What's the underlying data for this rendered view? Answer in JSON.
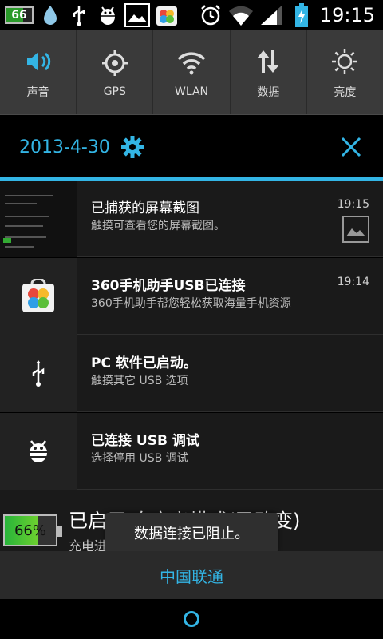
{
  "status_bar": {
    "battery_badge": "66",
    "time": "19:15",
    "icons": [
      "battery-level-icon",
      "droplet-icon",
      "usb-icon",
      "android-debug-icon",
      "picture-icon",
      "360-assistant-icon",
      "alarm-icon",
      "wifi-icon",
      "signal-icon",
      "charging-battery-icon"
    ]
  },
  "quick_settings": [
    {
      "label": "声音",
      "icon": "speaker-icon"
    },
    {
      "label": "GPS",
      "icon": "gps-icon"
    },
    {
      "label": "WLAN",
      "icon": "wifi-icon"
    },
    {
      "label": "数据",
      "icon": "data-transfer-icon"
    },
    {
      "label": "亮度",
      "icon": "brightness-icon"
    }
  ],
  "header": {
    "date": "2013-4-30",
    "settings_icon": "gear-icon",
    "close_icon": "close-icon"
  },
  "notifications": [
    {
      "title": "已捕获的屏幕截图",
      "text": "触摸可查看您的屏幕截图。",
      "time": "19:15",
      "icon": "screenshot-thumbnail"
    },
    {
      "title": "360手机助手USB已连接",
      "text": "360手机助手帮您轻松获取海量手机资源",
      "time": "19:14",
      "icon": "360-assistant-icon"
    },
    {
      "title": "PC 软件已启动。",
      "text": "触摸其它 USB 选项",
      "time": "",
      "icon": "usb-icon"
    },
    {
      "title": "已连接 USB 调试",
      "text": "选择停用 USB 调试",
      "time": "",
      "icon": "android-debug-icon"
    }
  ],
  "charging": {
    "percent": "66%",
    "title": "已启用 自定义模式(已改变)",
    "text": "充电进"
  },
  "toast": {
    "text": "数据连接已阻止。"
  },
  "carrier": {
    "name": "中国联通"
  },
  "colors": {
    "accent": "#33b5e5",
    "background": "#000000",
    "panel": "#1a1a1a"
  }
}
